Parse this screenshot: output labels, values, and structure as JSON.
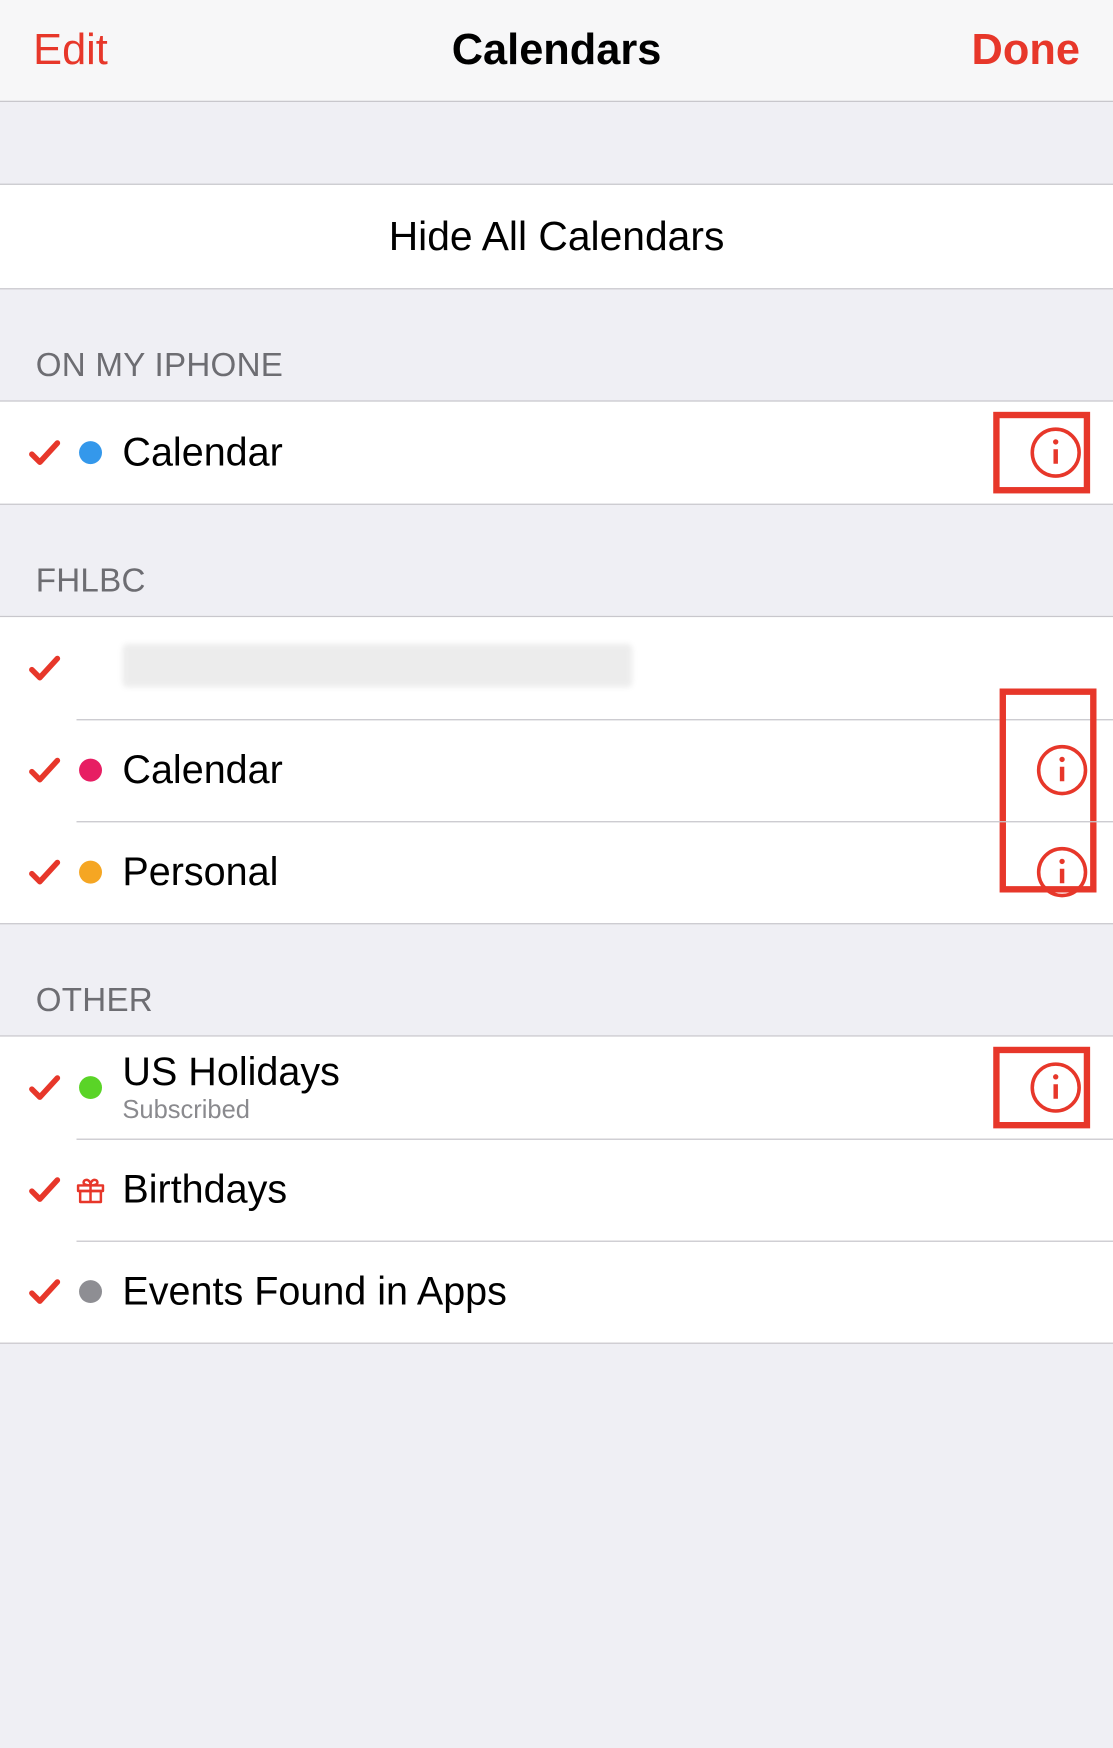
{
  "nav": {
    "edit": "Edit",
    "title": "Calendars",
    "done": "Done"
  },
  "hideAll": "Hide All Calendars",
  "accent": "#e7372a",
  "sections": [
    {
      "header": "ON MY IPHONE",
      "rows": [
        {
          "checked": true,
          "dotColor": "#3498eb",
          "name": "Calendar",
          "info": true,
          "boxed": true
        }
      ]
    },
    {
      "header": "FHLBC",
      "rows": [
        {
          "checked": true,
          "dotColor": "",
          "name": "",
          "info": false,
          "boxed": false,
          "obscured": true
        },
        {
          "checked": true,
          "dotColor": "#e71e63",
          "name": "Calendar",
          "info": true,
          "tallBoxStart": true
        },
        {
          "checked": true,
          "dotColor": "#f5a623",
          "name": "Personal",
          "info": true
        }
      ]
    },
    {
      "header": "OTHER",
      "rows": [
        {
          "checked": true,
          "dotColor": "#5ad427",
          "name": "US Holidays",
          "sub": "Subscribed",
          "info": true,
          "boxed": true
        },
        {
          "checked": true,
          "gift": true,
          "name": "Birthdays",
          "info": false
        },
        {
          "checked": true,
          "dotColor": "#8e8e93",
          "name": "Events Found in Apps",
          "info": false
        }
      ]
    }
  ]
}
